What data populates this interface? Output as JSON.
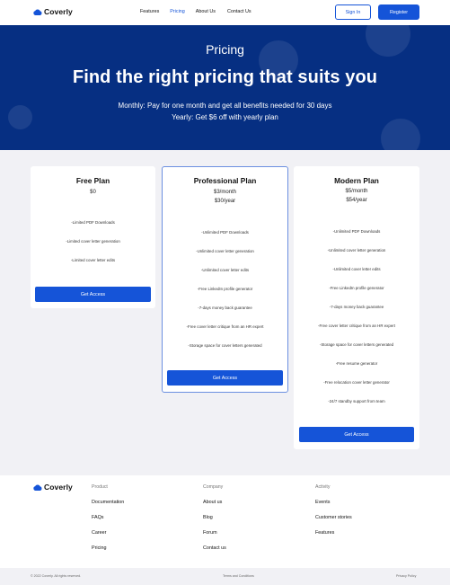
{
  "brand": {
    "name": "Coverly",
    "color": "#1554d8",
    "logo_icon": "cloud-logo-icon"
  },
  "nav": {
    "features": "Features",
    "pricing": "Pricing",
    "about": "About Us",
    "contact": "Contact Us"
  },
  "auth": {
    "signin": "Sign In",
    "register": "Register"
  },
  "hero": {
    "eyebrow": "Pricing",
    "title": "Find the right pricing that suits you",
    "line1": "Monthly: Pay for one month and get all benefits needed for 30 days",
    "line2": "Yearly: Get $6 off with yearly plan",
    "bg_color": "#062f82"
  },
  "plans": [
    {
      "name": "Free Plan",
      "price_monthly": "$0",
      "features": [
        "-Limited PDF Downloads",
        "-Limited cover letter generation",
        "-Limited cover letter edits"
      ],
      "cta": "Get Access"
    },
    {
      "name": "Professional Plan",
      "price_monthly": "$3/month",
      "price_yearly": "$30/year",
      "features": [
        "-Unlimited PDF Downloads",
        "-Unlimited cover letter generation",
        "-Unlimited cover letter edits",
        "-Free LinkedIn profile generator",
        "-7-days money back guarantee",
        "-Free cover letter critique from an HR expert",
        "-Storage space for cover letters generated"
      ],
      "cta": "Get Access"
    },
    {
      "name": "Modern Plan",
      "price_monthly": "$5/month",
      "price_yearly": "$54/year",
      "features": [
        "-Unlimited PDF Downloads",
        "-Unlimited cover letter generation",
        "-Unlimited cover letter edits",
        "-Free LinkedIn profile generator",
        "-7-days money back guarantee",
        "-Free cover letter critique from an HR expert",
        "-Storage space for cover letters generated",
        "-Free resume generator",
        "-Free relocation cover letter generator",
        "-24/7 standby support from team"
      ],
      "cta": "Get Access"
    }
  ],
  "footer": {
    "columns": [
      {
        "heading": "Product",
        "links": [
          "Documentation",
          "FAQs",
          "Career",
          "Pricing"
        ]
      },
      {
        "heading": "Company",
        "links": [
          "About us",
          "Blog",
          "Forum",
          "Contact us"
        ]
      },
      {
        "heading": "Activity",
        "links": [
          "Events",
          "Customer stories",
          "Features"
        ]
      }
    ],
    "copyright": "© 2022 Coverly. All rights reserved.",
    "terms": "Terms and Conditions",
    "privacy": "Privacy Policy"
  }
}
